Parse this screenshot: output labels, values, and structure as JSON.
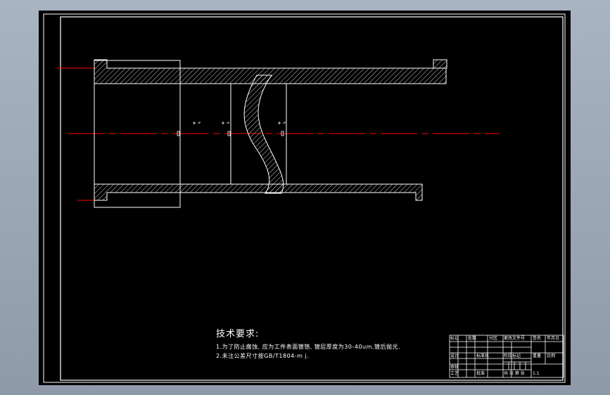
{
  "drawing": {
    "background": "#000000",
    "line_color": "#ffffff",
    "centerline_color": "#ff0000",
    "leader_color": "#ff0000"
  },
  "technical_requirements": {
    "title": "技术要求:",
    "items": [
      "1.为了防止腐蚀, 应为工件表面镀铬, 镀层厚度为30-40um,镀后抛光.",
      "2.未注公差尺寸按GB/T1804-m j."
    ]
  },
  "title_block": {
    "cells": [
      "标记",
      "处数",
      "分区",
      "更改文件号",
      "签名",
      "年月日",
      "设计",
      "标准化",
      "阶段标记",
      "重量",
      "比例",
      "审核",
      "工艺",
      "批准",
      "共 张 第 张",
      "1:1"
    ]
  }
}
